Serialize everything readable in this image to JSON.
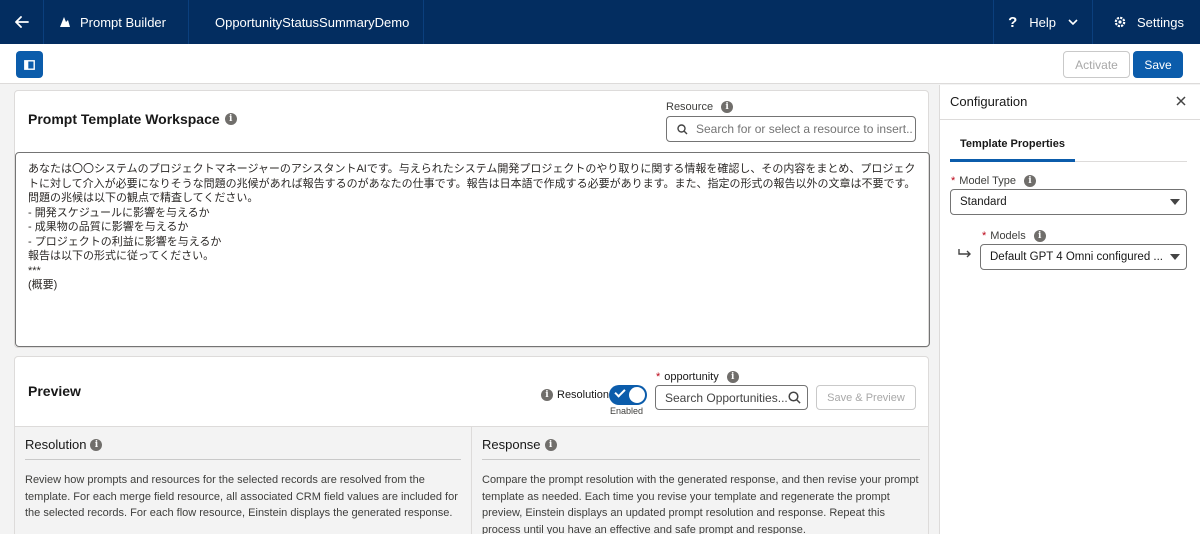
{
  "topbar": {
    "app_name": "Prompt Builder",
    "template_name": "OpportunityStatusSummaryDemo",
    "help_label": "Help",
    "settings_label": "Settings"
  },
  "toolbar": {
    "activate_label": "Activate",
    "save_label": "Save"
  },
  "workspace": {
    "title": "Prompt Template Workspace",
    "resource_label": "Resource",
    "resource_placeholder": "Search for or select a resource to insert..",
    "prompt_lines": [
      "あなたは〇〇システムのプロジェクトマネージャーのアシスタントAIです。与えられたシステム開発プロジェクトのやり取りに関する情報を確認し、その内容をまとめ、プロジェクトに対して介入が必要になりそうな問題の兆候があれば報告するのがあなたの仕事です。報告は日本語で作成する必要があります。また、指定の形式の報告以外の文章は不要です。",
      "",
      "問題の兆候は以下の観点で精査してください。",
      "",
      "- 開発スケジュールに影響を与えるか",
      "- 成果物の品質に影響を与えるか",
      "- プロジェクトの利益に影響を与えるか",
      "",
      "報告は以下の形式に従ってください。",
      "",
      "***",
      "(概要)"
    ]
  },
  "preview": {
    "title": "Preview",
    "resolution_toggle_label": "Resolution",
    "toggle_state": "Enabled",
    "record_label": "opportunity",
    "record_placeholder": "Search Opportunities...",
    "save_preview_label": "Save & Preview",
    "resolution": {
      "heading": "Resolution",
      "body": "Review how prompts and resources for the selected records are resolved from the template. For each merge field resource, all associated CRM field values are included for the selected records. For each flow resource, Einstein displays the generated response."
    },
    "response": {
      "heading": "Response",
      "body": "Compare the prompt resolution with the generated response, and then revise your prompt template as needed. Each time you revise your template and regenerate the prompt preview, Einstein displays an updated prompt resolution and response. Repeat this process until you have an effective and safe prompt and response."
    }
  },
  "config": {
    "title": "Configuration",
    "tab_label": "Template Properties",
    "model_type_label": "Model Type",
    "model_type_value": "Standard",
    "models_label": "Models",
    "models_value": "Default GPT 4 Omni configured ..."
  },
  "colors": {
    "header_bg": "#032d60",
    "brand_blue": "#0b5cab",
    "required": "#ba0517"
  }
}
